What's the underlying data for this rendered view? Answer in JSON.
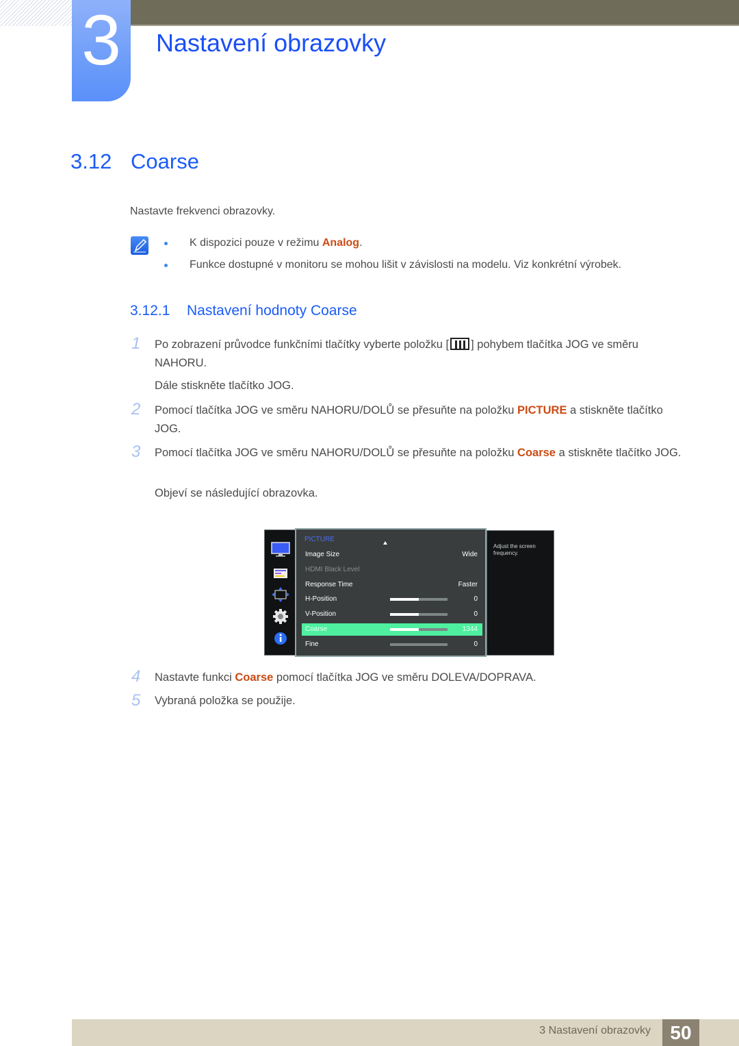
{
  "chapter": {
    "number": "3",
    "title": "Nastavení obrazovky"
  },
  "section": {
    "number": "3.12",
    "title": "Coarse",
    "intro": "Nastavte frekvenci obrazovky."
  },
  "notes": {
    "icon": "note-pencil-icon",
    "items": [
      {
        "text_before": "K dispozici pouze v režimu ",
        "highlight": "Analog",
        "text_after": "."
      },
      {
        "text_before": "Funkce dostupné v monitoru se mohou lišit v závislosti na modelu. Viz konkrétní výrobek.",
        "highlight": "",
        "text_after": ""
      }
    ]
  },
  "subsection": {
    "number": "3.12.1",
    "title": "Nastavení hodnoty Coarse"
  },
  "steps": [
    {
      "num": "1",
      "line1_before": "Po zobrazení průvodce funkčními tlačítky vyberte položku [",
      "icon": "menu-grid-icon",
      "line1_after": "] pohybem tlačítka JOG ve směru",
      "line2": "NAHORU.",
      "sub": "Dále stiskněte tlačítko JOG."
    },
    {
      "num": "2",
      "text_before": "Pomocí tlačítka JOG ve směru NAHORU/DOLŮ se přesuňte na položku ",
      "highlight": "PICTURE",
      "text_after": " a stiskněte tlačítko JOG."
    },
    {
      "num": "3",
      "text_before": "Pomocí tlačítka JOG ve směru NAHORU/DOLŮ se přesuňte na položku ",
      "highlight": "Coarse",
      "text_after": " a stiskněte tlačítko JOG.",
      "sub": "Objeví se následující obrazovka."
    },
    {
      "num": "4",
      "text_before": "Nastavte funkci ",
      "highlight": "Coarse",
      "text_after": " pomocí tlačítka JOG ve směru DOLEVA/DOPRAVA."
    },
    {
      "num": "5",
      "text_before": "Vybraná položka se použije.",
      "highlight": "",
      "text_after": ""
    }
  ],
  "osd": {
    "side_icons": [
      "monitor-icon",
      "picture-settings-icon",
      "resize-arrows-icon",
      "gear-icon",
      "info-icon"
    ],
    "header": "PICTURE",
    "rows": [
      {
        "label": "Image Size",
        "value": "Wide",
        "state": "normal"
      },
      {
        "label": "HDMI Black Level",
        "value": "",
        "state": "disabled"
      },
      {
        "label": "Response Time",
        "value": "Faster",
        "state": "normal"
      },
      {
        "label": "H-Position",
        "value": "0",
        "state": "normal",
        "bar_fraction": 0.5
      },
      {
        "label": "V-Position",
        "value": "0",
        "state": "normal",
        "bar_fraction": 0.5
      },
      {
        "label": "Coarse",
        "value": "1344",
        "state": "selected",
        "bar_fraction": 0.5
      },
      {
        "label": "Fine",
        "value": "0",
        "state": "normal",
        "bar_fraction": 0
      }
    ],
    "help_text": "Adjust the screen frequency."
  },
  "footer": {
    "text": "3 Nastavení obrazovky",
    "page": "50"
  }
}
